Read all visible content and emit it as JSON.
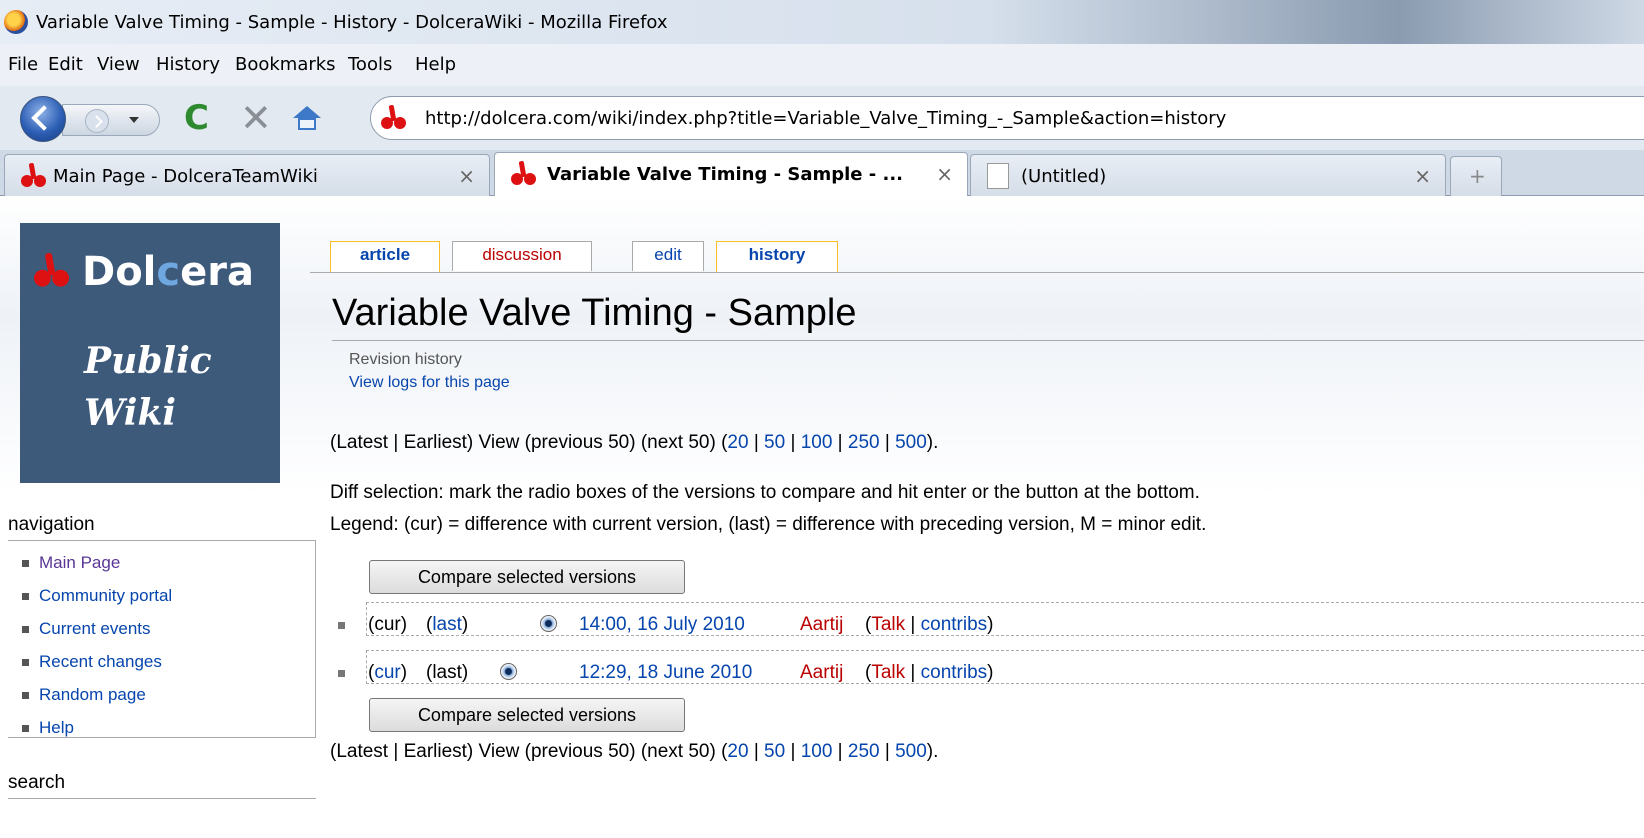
{
  "window": {
    "title": "Variable Valve Timing - Sample - History - DolceraWiki - Mozilla Firefox"
  },
  "menu": [
    "File",
    "Edit",
    "View",
    "History",
    "Bookmarks",
    "Tools",
    "Help"
  ],
  "toolbar": {
    "url": "http://dolcera.com/wiki/index.php?title=Variable_Valve_Timing_-_Sample&action=history"
  },
  "tabs": [
    {
      "label": "Main Page - DolceraTeamWiki",
      "close": "×"
    },
    {
      "label": "Variable Valve Timing - Sample - ...",
      "close": "×"
    },
    {
      "label": "(Untitled)",
      "close": "×"
    }
  ],
  "newtab_symbol": "+",
  "logo": {
    "brand_a": "Dol",
    "brand_b": "c",
    "brand_c": "era",
    "line1": "Public",
    "line2": "Wiki"
  },
  "sidebar": {
    "nav_heading": "navigation",
    "items": [
      "Main Page",
      "Community portal",
      "Current events",
      "Recent changes",
      "Random page",
      "Help"
    ],
    "search_heading": "search"
  },
  "content_tabs": [
    "article",
    "discussion",
    "edit",
    "history"
  ],
  "page": {
    "title": "Variable Valve Timing - Sample",
    "subtitle": "Revision history",
    "logs_link": "View logs for this page",
    "nav_prefix": "(Latest | Earliest) View (previous 50) (next 50) (",
    "nav_counts": [
      "20",
      "50",
      "100",
      "250",
      "500"
    ],
    "nav_suffix": ").",
    "sep": " | ",
    "diff_help": "Diff selection: mark the radio boxes of the versions to compare and hit enter or the button at the bottom.",
    "legend": "Legend: (cur) = difference with current version, (last) = difference with preceding version, M = minor edit.",
    "compare_button": "Compare selected versions"
  },
  "history": [
    {
      "cur": "(cur)",
      "last_open": "(",
      "last": "last",
      "last_close": ")",
      "date": "14:00, 16 July 2010",
      "user": "Aartij",
      "talk": "Talk",
      "contribs": "contribs"
    },
    {
      "cur_open": "(",
      "cur": "cur",
      "cur_close": ")",
      "last": "(last)",
      "date": "12:29, 18 June 2010",
      "user": "Aartij",
      "talk": "Talk",
      "contribs": "contribs"
    }
  ]
}
